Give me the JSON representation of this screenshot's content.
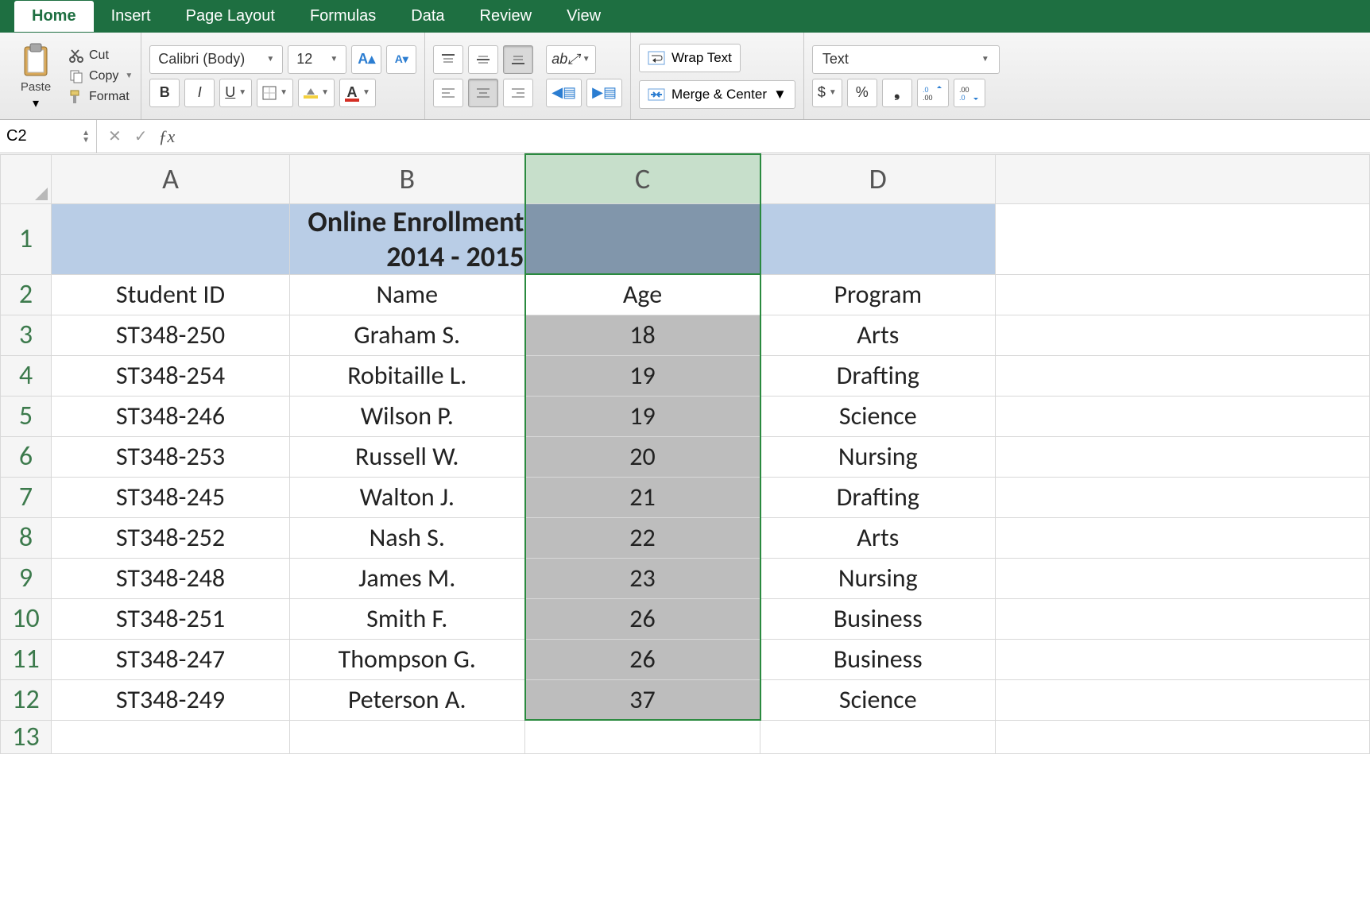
{
  "tabs": {
    "home": "Home",
    "insert": "Insert",
    "pagelayout": "Page Layout",
    "formulas": "Formulas",
    "data": "Data",
    "review": "Review",
    "view": "View"
  },
  "clipboard": {
    "paste": "Paste",
    "cut": "Cut",
    "copy": "Copy",
    "format": "Format"
  },
  "font": {
    "name": "Calibri (Body)",
    "size": "12",
    "bold": "B",
    "italic": "I",
    "underline": "U"
  },
  "alignment": {
    "wrap": "Wrap Text",
    "merge": "Merge & Center"
  },
  "number": {
    "format": "Text",
    "currency": "$",
    "percent": "%",
    "comma": "❟",
    "inc": ".0 .00",
    "dec": ".00 .0"
  },
  "formulaBar": {
    "nameBox": "C2",
    "fx": "ƒx",
    "formula": ""
  },
  "columns": [
    "A",
    "B",
    "C",
    "D"
  ],
  "title": "Online Enrollment 2014 - 2015",
  "headers": {
    "a": "Student ID",
    "b": "Name",
    "c": "Age",
    "d": "Program"
  },
  "rows": [
    {
      "n": "3",
      "a": "ST348-250",
      "b": "Graham S.",
      "c": "18",
      "d": "Arts"
    },
    {
      "n": "4",
      "a": "ST348-254",
      "b": "Robitaille L.",
      "c": "19",
      "d": "Drafting"
    },
    {
      "n": "5",
      "a": "ST348-246",
      "b": "Wilson P.",
      "c": "19",
      "d": "Science"
    },
    {
      "n": "6",
      "a": "ST348-253",
      "b": "Russell W.",
      "c": "20",
      "d": "Nursing"
    },
    {
      "n": "7",
      "a": "ST348-245",
      "b": "Walton J.",
      "c": "21",
      "d": "Drafting"
    },
    {
      "n": "8",
      "a": "ST348-252",
      "b": "Nash S.",
      "c": "22",
      "d": "Arts"
    },
    {
      "n": "9",
      "a": "ST348-248",
      "b": "James M.",
      "c": "23",
      "d": "Nursing"
    },
    {
      "n": "10",
      "a": "ST348-251",
      "b": "Smith F.",
      "c": "26",
      "d": "Business"
    },
    {
      "n": "11",
      "a": "ST348-247",
      "b": "Thompson G.",
      "c": "26",
      "d": "Business"
    },
    {
      "n": "12",
      "a": "ST348-249",
      "b": "Peterson A.",
      "c": "37",
      "d": "Science"
    }
  ]
}
